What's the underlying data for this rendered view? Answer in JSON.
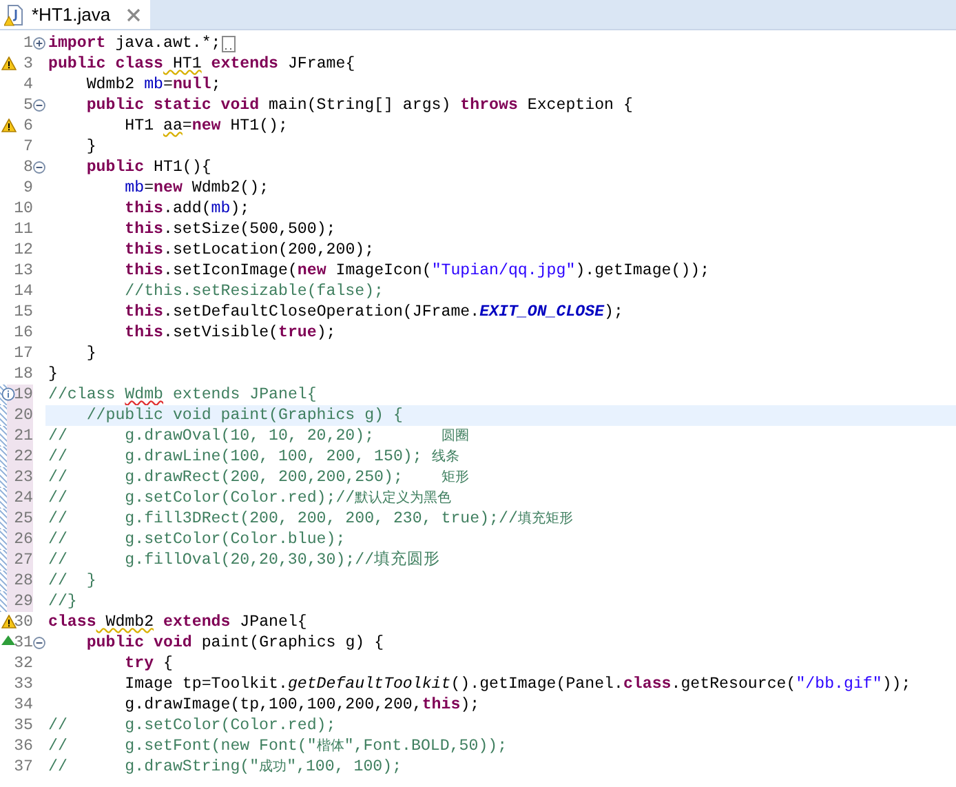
{
  "tabs": [
    {
      "label": "*HT1.java",
      "selected": true,
      "warning": true
    }
  ],
  "lines": [
    {
      "number": "1",
      "folded": true,
      "collapsed": true,
      "tokens": [
        {
          "kind": "kw",
          "text": "import"
        },
        {
          "kind": "text",
          "text": " java.awt.*;"
        }
      ]
    },
    {
      "number": "3",
      "warning": true,
      "tokens": [
        {
          "kind": "kw",
          "text": "public class"
        },
        {
          "kind": "warned",
          "text": " HT1"
        },
        {
          "kind": "kw",
          "text": " extends"
        },
        {
          "kind": "text",
          "text": " JFrame{"
        }
      ]
    },
    {
      "number": "4",
      "tokens": [
        {
          "kind": "text",
          "text": "    Wdmb2 "
        },
        {
          "kind": "field",
          "text": "mb"
        },
        {
          "kind": "text",
          "text": "="
        },
        {
          "kind": "kw",
          "text": "null"
        },
        {
          "kind": "text",
          "text": ";"
        }
      ]
    },
    {
      "number": "5",
      "folded": false,
      "tokens": [
        {
          "kind": "kw",
          "text": "    public static void"
        },
        {
          "kind": "text",
          "text": " main(String[] args) "
        },
        {
          "kind": "kw",
          "text": "throws"
        },
        {
          "kind": "text",
          "text": " Exception {"
        }
      ]
    },
    {
      "number": "6",
      "warning": true,
      "tokens": [
        {
          "kind": "text",
          "text": "        HT1 "
        },
        {
          "kind": "warned",
          "text": "aa"
        },
        {
          "kind": "text",
          "text": "="
        },
        {
          "kind": "kw",
          "text": "new"
        },
        {
          "kind": "text",
          "text": " HT1();"
        }
      ]
    },
    {
      "number": "7",
      "tokens": [
        {
          "kind": "text",
          "text": "    }"
        }
      ]
    },
    {
      "number": "8",
      "folded": false,
      "tokens": [
        {
          "kind": "kw",
          "text": "    public"
        },
        {
          "kind": "text",
          "text": " HT1(){"
        }
      ]
    },
    {
      "number": "9",
      "tokens": [
        {
          "kind": "field",
          "text": "        mb"
        },
        {
          "kind": "text",
          "text": "="
        },
        {
          "kind": "kw",
          "text": "new"
        },
        {
          "kind": "text",
          "text": " Wdmb2();"
        }
      ]
    },
    {
      "number": "10",
      "tokens": [
        {
          "kind": "kw",
          "text": "        this"
        },
        {
          "kind": "text",
          "text": ".add("
        },
        {
          "kind": "field",
          "text": "mb"
        },
        {
          "kind": "text",
          "text": ");"
        }
      ]
    },
    {
      "number": "11",
      "tokens": [
        {
          "kind": "kw",
          "text": "        this"
        },
        {
          "kind": "text",
          "text": ".setSize(500,500);"
        }
      ]
    },
    {
      "number": "12",
      "tokens": [
        {
          "kind": "kw",
          "text": "        this"
        },
        {
          "kind": "text",
          "text": ".setLocation(200,200);"
        }
      ]
    },
    {
      "number": "13",
      "tokens": [
        {
          "kind": "kw",
          "text": "        this"
        },
        {
          "kind": "text",
          "text": ".setIconImage("
        },
        {
          "kind": "kw",
          "text": "new"
        },
        {
          "kind": "text",
          "text": " ImageIcon("
        },
        {
          "kind": "string",
          "text": "\"Tupian/qq.jpg\""
        },
        {
          "kind": "text",
          "text": ").getImage());"
        }
      ]
    },
    {
      "number": "14",
      "tokens": [
        {
          "kind": "comment",
          "text": "        //this.setResizable(false);"
        }
      ]
    },
    {
      "number": "15",
      "tokens": [
        {
          "kind": "kw",
          "text": "        this"
        },
        {
          "kind": "text",
          "text": ".setDefaultCloseOperation(JFrame."
        },
        {
          "kind": "static-field",
          "text": "EXIT_ON_CLOSE"
        },
        {
          "kind": "text",
          "text": ");"
        }
      ]
    },
    {
      "number": "16",
      "tokens": [
        {
          "kind": "kw",
          "text": "        this"
        },
        {
          "kind": "text",
          "text": ".setVisible("
        },
        {
          "kind": "kw",
          "text": "true"
        },
        {
          "kind": "text",
          "text": ");"
        }
      ]
    },
    {
      "number": "17",
      "tokens": [
        {
          "kind": "text",
          "text": "    }"
        }
      ]
    },
    {
      "number": "18",
      "tokens": [
        {
          "kind": "text",
          "text": "}"
        }
      ]
    },
    {
      "number": "19",
      "info": true,
      "changed": true,
      "tokens": [
        {
          "kind": "comment",
          "text": "//class "
        },
        {
          "kind": "comment-spell",
          "text": "Wdmb"
        },
        {
          "kind": "comment",
          "text": " extends JPanel{"
        }
      ]
    },
    {
      "number": "20",
      "changed": true,
      "current": true,
      "tokens": [
        {
          "kind": "comment",
          "text": "    //public void paint(Graphics g) {"
        }
      ]
    },
    {
      "number": "21",
      "changed": true,
      "tokens": [
        {
          "kind": "comment",
          "text": "//      g.drawOval(10, 10, 20,20);       "
        },
        {
          "kind": "small-comment",
          "text": "圆圈"
        }
      ]
    },
    {
      "number": "22",
      "changed": true,
      "tokens": [
        {
          "kind": "comment",
          "text": "//      g.drawLine(100, 100, 200, 150); "
        },
        {
          "kind": "small-comment",
          "text": "线条"
        }
      ]
    },
    {
      "number": "23",
      "changed": true,
      "tokens": [
        {
          "kind": "comment",
          "text": "//      g.drawRect(200, 200,200,250);    "
        },
        {
          "kind": "small-comment",
          "text": "矩形"
        }
      ]
    },
    {
      "number": "24",
      "changed": true,
      "tokens": [
        {
          "kind": "comment",
          "text": "//      g.setColor(Color.red);//"
        },
        {
          "kind": "small-comment",
          "text": "默认定义为黑色"
        }
      ]
    },
    {
      "number": "25",
      "changed": true,
      "tokens": [
        {
          "kind": "comment",
          "text": "//      g.fill3DRect(200, 200, 200, 230, true);//"
        },
        {
          "kind": "small-comment",
          "text": "填充矩形"
        }
      ]
    },
    {
      "number": "26",
      "changed": true,
      "tokens": [
        {
          "kind": "comment",
          "text": "//      g.setColor(Color.blue);"
        }
      ]
    },
    {
      "number": "27",
      "changed": true,
      "tokens": [
        {
          "kind": "comment",
          "text": "//      g.fillOval(20,20,30,30);//填充圆形"
        }
      ]
    },
    {
      "number": "28",
      "changed": true,
      "tokens": [
        {
          "kind": "comment",
          "text": "//  }"
        }
      ]
    },
    {
      "number": "29",
      "changed": true,
      "tokens": [
        {
          "kind": "comment",
          "text": "//}"
        }
      ]
    },
    {
      "number": "30",
      "warning": true,
      "tokens": [
        {
          "kind": "kw",
          "text": "class"
        },
        {
          "kind": "warned",
          "text": " Wdmb2"
        },
        {
          "kind": "kw",
          "text": " extends"
        },
        {
          "kind": "text",
          "text": " JPanel{"
        }
      ]
    },
    {
      "number": "31",
      "override": true,
      "folded": false,
      "tokens": [
        {
          "kind": "kw",
          "text": "    public void"
        },
        {
          "kind": "text",
          "text": " paint(Graphics g) {"
        }
      ]
    },
    {
      "number": "32",
      "tokens": [
        {
          "kind": "kw",
          "text": "        try"
        },
        {
          "kind": "text",
          "text": " {"
        }
      ]
    },
    {
      "number": "33",
      "tokens": [
        {
          "kind": "text",
          "text": "        Image tp=Toolkit."
        },
        {
          "kind": "static-method",
          "text": "getDefaultToolkit"
        },
        {
          "kind": "text",
          "text": "().getImage(Panel."
        },
        {
          "kind": "kw",
          "text": "class"
        },
        {
          "kind": "text",
          "text": ".getResource("
        },
        {
          "kind": "string",
          "text": "\"/bb.gif\""
        },
        {
          "kind": "text",
          "text": "));"
        }
      ]
    },
    {
      "number": "34",
      "tokens": [
        {
          "kind": "text",
          "text": "        g.drawImage(tp,100,100,200,200,"
        },
        {
          "kind": "kw",
          "text": "this"
        },
        {
          "kind": "text",
          "text": ");"
        }
      ]
    },
    {
      "number": "35",
      "tokens": [
        {
          "kind": "comment",
          "text": "//      g.setColor(Color.red);"
        }
      ]
    },
    {
      "number": "36",
      "tokens": [
        {
          "kind": "comment",
          "text": "//      g.setFont(new Font(\""
        },
        {
          "kind": "small-comment",
          "text": "楷体"
        },
        {
          "kind": "comment",
          "text": "\",Font.BOLD,50));"
        }
      ]
    },
    {
      "number": "37",
      "tokens": [
        {
          "kind": "comment",
          "text": "//      g.drawString(\""
        },
        {
          "kind": "small-comment",
          "text": "成功"
        },
        {
          "kind": "comment",
          "text": "\",100, 100);"
        }
      ]
    }
  ]
}
